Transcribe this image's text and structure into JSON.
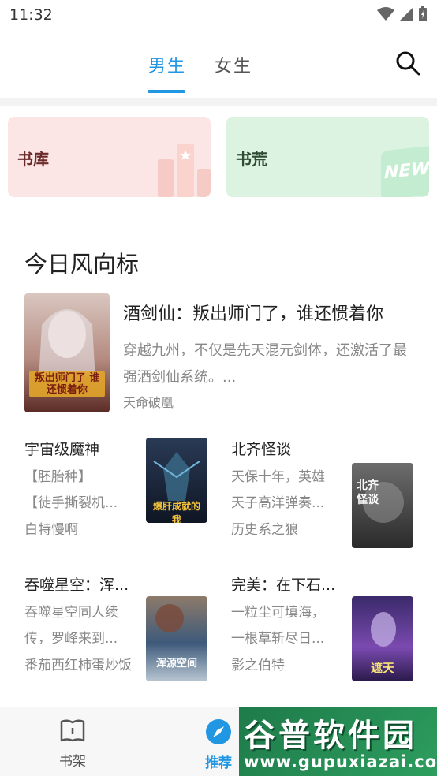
{
  "status_bar": {
    "time": "11:32"
  },
  "header": {
    "tabs": [
      {
        "label": "男生",
        "active": true
      },
      {
        "label": "女生",
        "active": false
      }
    ]
  },
  "categories": [
    {
      "label": "书库"
    },
    {
      "label": "书荒",
      "badge": "NEW"
    }
  ],
  "section": {
    "title": "今日风向标"
  },
  "featured": {
    "title": "酒剑仙：叛出师门了，谁还惯着你",
    "description": "穿越九州，不仅是先天混元剑体，还激活了最强酒剑仙系统。...",
    "author": "天命破凰",
    "cover_text": "叛出师门了 谁还惯着你"
  },
  "books": [
    {
      "title": "宇宙级魔神",
      "desc_line1": "【胚胎种】",
      "desc_line2": "【徒手撕裂机...",
      "author": "白特慢啊",
      "cover_text": "爆肝成就的我"
    },
    {
      "title": "北齐怪谈",
      "desc_line1": "天保十年，英雄",
      "desc_line2": "天子高洋弹奏...",
      "author": "历史系之狼",
      "cover_text": "北齐怪谈"
    },
    {
      "title": "吞噬星空：浑...",
      "desc_line1": "吞噬星空同人续",
      "desc_line2": "传，罗峰来到...",
      "author": "番茄西红柿蛋炒饭",
      "cover_text": "浑源空间"
    },
    {
      "title": "完美：在下石...",
      "desc_line1": "一粒尘可填海，",
      "desc_line2": "一根草斩尽日...",
      "author": "影之伯特",
      "cover_text": "遮天"
    }
  ],
  "bottom_nav": [
    {
      "label": "书架",
      "icon": "book-icon",
      "active": false
    },
    {
      "label": "推荐",
      "icon": "compass-icon",
      "active": true
    }
  ],
  "watermark": {
    "title": "谷普软件园",
    "url": "www.gupuxiazai.com"
  },
  "colors": {
    "accent": "#2196e3",
    "text": "#222222",
    "muted": "#888888"
  }
}
